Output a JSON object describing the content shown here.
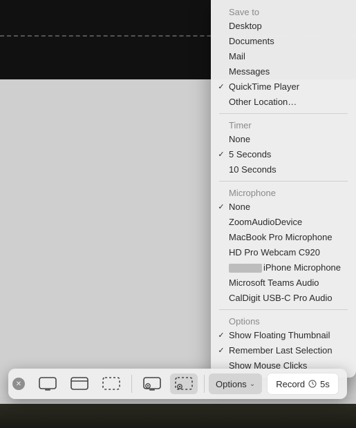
{
  "toolbar": {
    "options_label": "Options",
    "record_label": "Record",
    "timer_indicator": "5s"
  },
  "menu": {
    "save_to": {
      "header": "Save to",
      "items": [
        {
          "label": "Desktop",
          "checked": false
        },
        {
          "label": "Documents",
          "checked": false
        },
        {
          "label": "Mail",
          "checked": false
        },
        {
          "label": "Messages",
          "checked": false
        },
        {
          "label": "QuickTime Player",
          "checked": true
        },
        {
          "label": "Other Location…",
          "checked": false
        }
      ]
    },
    "timer": {
      "header": "Timer",
      "items": [
        {
          "label": "None",
          "checked": false
        },
        {
          "label": "5 Seconds",
          "checked": true
        },
        {
          "label": "10 Seconds",
          "checked": false
        }
      ]
    },
    "microphone": {
      "header": "Microphone",
      "items": [
        {
          "label": "None",
          "checked": true
        },
        {
          "label": "ZoomAudioDevice",
          "checked": false
        },
        {
          "label": "MacBook Pro Microphone",
          "checked": false
        },
        {
          "label": "HD Pro Webcam C920",
          "checked": false
        },
        {
          "label": "iPhone Microphone",
          "checked": false,
          "redacted_prefix": true
        },
        {
          "label": "Microsoft Teams Audio",
          "checked": false
        },
        {
          "label": "CalDigit USB-C Pro Audio",
          "checked": false
        }
      ]
    },
    "options": {
      "header": "Options",
      "items": [
        {
          "label": "Show Floating Thumbnail",
          "checked": true
        },
        {
          "label": "Remember Last Selection",
          "checked": true
        },
        {
          "label": "Show Mouse Clicks",
          "checked": false
        }
      ]
    }
  }
}
